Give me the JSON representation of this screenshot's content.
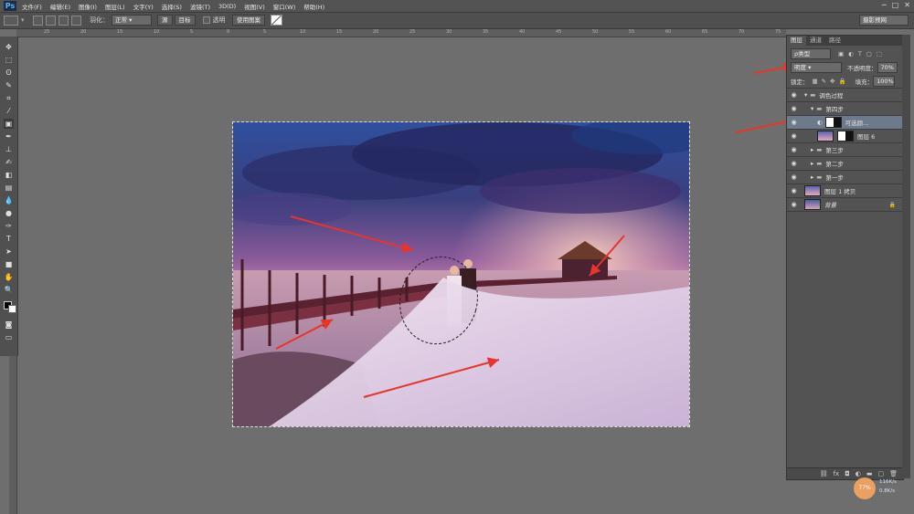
{
  "app": {
    "logo": "Ps"
  },
  "menu": [
    "文件(F)",
    "编辑(E)",
    "图像(I)",
    "图层(L)",
    "文字(Y)",
    "选择(S)",
    "滤镜(T)",
    "3D(D)",
    "视图(V)",
    "窗口(W)",
    "帮助(H)"
  ],
  "window_controls": [
    "─",
    "□",
    "✕"
  ],
  "options": {
    "feather_label": "羽化：",
    "mode_value": "正常",
    "btn_from": "源",
    "btn_to": "目标",
    "transparent_label": "透明",
    "use_pattern": "使用图案",
    "workspace": "摄影预网"
  },
  "ruler_ticks": [
    "25",
    "20",
    "15",
    "10",
    "5",
    "0",
    "5",
    "10",
    "15",
    "20",
    "25",
    "30",
    "35",
    "40",
    "45",
    "50",
    "55",
    "60",
    "65",
    "70",
    "75"
  ],
  "layers_panel": {
    "tabs": [
      "图层",
      "通道",
      "路径"
    ],
    "kind_label": "ρ类型",
    "blend_mode": "明度",
    "opacity_label": "不透明度：",
    "opacity_value": "70%",
    "lock_label": "锁定：",
    "fill_label": "填充：",
    "fill_value": "100%",
    "layers": [
      {
        "name": "调色过程",
        "type": "group",
        "indent": 1,
        "expanded": true
      },
      {
        "name": "第四步",
        "type": "group",
        "indent": 2,
        "expanded": true
      },
      {
        "name": "可选颜...",
        "type": "adjustment",
        "indent": 3,
        "selected": true
      },
      {
        "name": "图层 6",
        "type": "layer",
        "indent": 3
      },
      {
        "name": "第三步",
        "type": "group",
        "indent": 2
      },
      {
        "name": "第二步",
        "type": "group",
        "indent": 2
      },
      {
        "name": "第一步",
        "type": "group",
        "indent": 2
      },
      {
        "name": "图层 1 拷贝",
        "type": "layer",
        "indent": 1
      },
      {
        "name": "背景",
        "type": "background",
        "indent": 1
      }
    ],
    "bottom_icons": [
      "link-icon",
      "fx-icon",
      "mask-icon",
      "adjustment-icon",
      "folder-icon",
      "new-layer-icon",
      "trash-icon"
    ]
  },
  "net_widget": {
    "percent": "77%",
    "up": "116K/s",
    "down": "0.8K/s"
  },
  "colors": {
    "accent_arrow": "#e8342a",
    "selected_row": "#6c7a8c"
  }
}
